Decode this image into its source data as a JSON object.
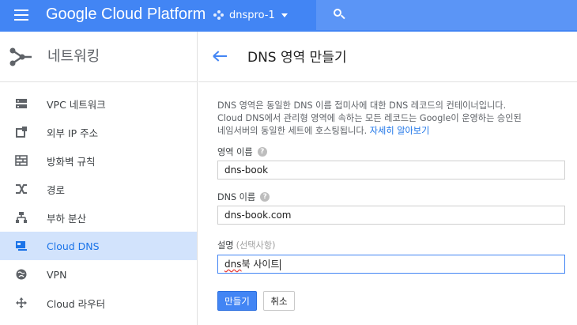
{
  "topbar": {
    "brand": "Google Cloud Platform",
    "project": "dnspro-1"
  },
  "sidebar": {
    "title": "네트워킹",
    "items": [
      {
        "label": "VPC 네트워크",
        "icon": "vpc-network-icon"
      },
      {
        "label": "외부 IP 주소",
        "icon": "external-ip-icon"
      },
      {
        "label": "방화벽 규칙",
        "icon": "firewall-icon"
      },
      {
        "label": "경로",
        "icon": "routes-icon"
      },
      {
        "label": "부하 분산",
        "icon": "load-balancing-icon"
      },
      {
        "label": "Cloud DNS",
        "icon": "cloud-dns-icon",
        "active": true
      },
      {
        "label": "VPN",
        "icon": "vpn-icon"
      },
      {
        "label": "Cloud 라우터",
        "icon": "cloud-router-icon"
      }
    ]
  },
  "main": {
    "title": "DNS 영역 만들기",
    "intro_line1": "DNS 영역은 동일한 DNS 이름 접미사에 대한 DNS 레코드의 컨테이너입니다.",
    "intro_line2": "Cloud DNS에서 관리형 영역에 속하는 모든 레코드는 Google이 운영하는 승인된",
    "intro_line3": "네임서버의 동일한 세트에 호스팅됩니다.",
    "learn_more": "자세히 알아보기",
    "fields": {
      "zone_name": {
        "label": "영역 이름",
        "value": "dns-book"
      },
      "dns_name": {
        "label": "DNS 이름",
        "value": "dns-book.com"
      },
      "description": {
        "label": "설명",
        "optional": "(선택사항)",
        "value_misspelled": "dns",
        "value_rest": "북 사이트"
      }
    },
    "buttons": {
      "create": "만들기",
      "cancel": "취소"
    }
  },
  "colors": {
    "accent": "#4285f4",
    "active_bg": "#d2e3fc",
    "active_text": "#1a73e8"
  }
}
